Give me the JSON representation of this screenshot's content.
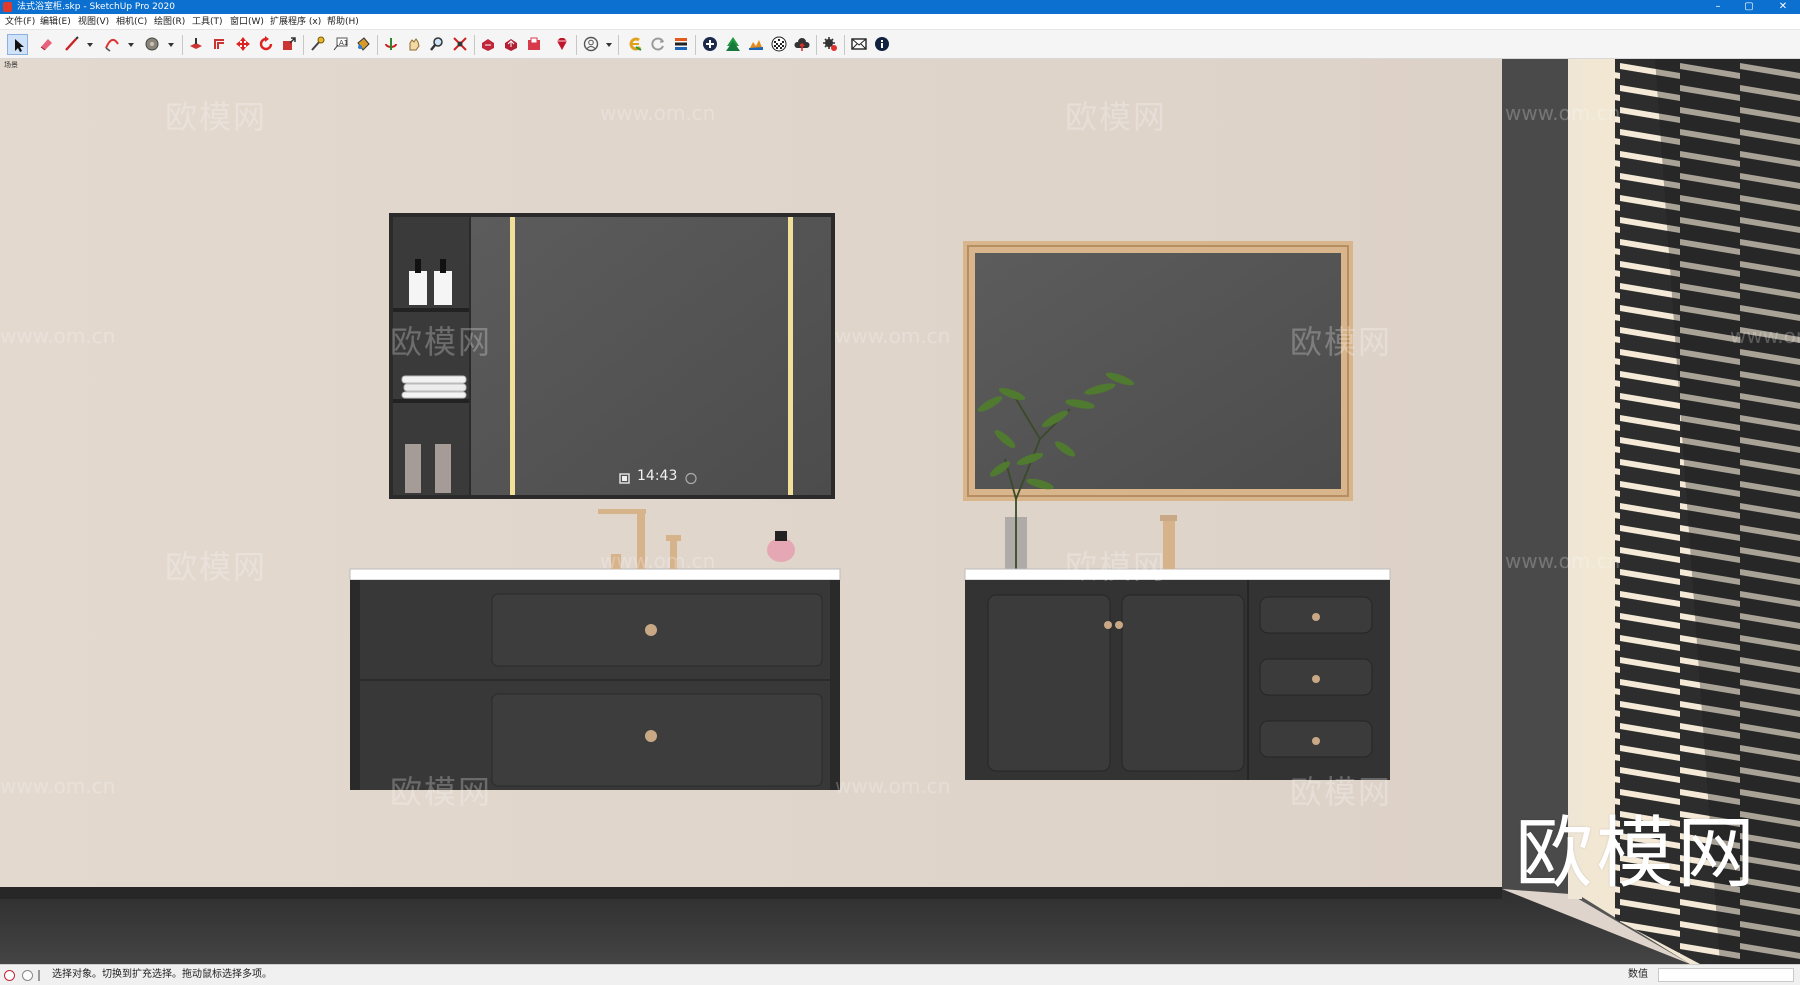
{
  "window": {
    "title": "法式浴室柜.skp - SketchUp Pro 2020",
    "controls": {
      "minimize": "–",
      "maximize": "▢",
      "close": "✕"
    }
  },
  "menu": [
    "文件(F)",
    "编辑(E)",
    "视图(V)",
    "相机(C)",
    "绘图(R)",
    "工具(T)",
    "窗口(W)",
    "扩展程序 (x)",
    "帮助(H)"
  ],
  "toolbar": {
    "tools": [
      {
        "name": "select-tool-icon",
        "selected": true
      },
      {
        "name": "eraser-tool-icon"
      },
      {
        "name": "line-tool-icon",
        "dropdown": true
      },
      {
        "name": "arc-tool-icon",
        "dropdown": true
      },
      {
        "name": "shapes-tool-icon",
        "dropdown": true
      },
      {
        "name": "push-pull-tool-icon"
      },
      {
        "name": "offset-tool-icon"
      },
      {
        "name": "move-tool-icon"
      },
      {
        "name": "rotate-tool-icon"
      },
      {
        "name": "scale-tool-icon"
      },
      {
        "name": "tape-measure-tool-icon"
      },
      {
        "name": "text-tool-icon"
      },
      {
        "name": "paint-bucket-tool-icon"
      },
      {
        "name": "orbit-tool-icon"
      },
      {
        "name": "pan-tool-icon"
      },
      {
        "name": "zoom-tool-icon"
      },
      {
        "name": "zoom-extents-tool-icon"
      },
      {
        "name": "warehouse-icon"
      },
      {
        "name": "share-model-icon"
      },
      {
        "name": "extension-warehouse-icon"
      },
      {
        "name": "ruby-console-icon"
      },
      {
        "name": "user-account-icon",
        "dropdown": true
      },
      {
        "name": "plugin-e-icon"
      },
      {
        "name": "refresh-icon"
      },
      {
        "name": "layers-stack-icon"
      },
      {
        "name": "add-circle-icon"
      },
      {
        "name": "tree-icon"
      },
      {
        "name": "terrain-icon"
      },
      {
        "name": "checker-sphere-icon"
      },
      {
        "name": "cloud-upload-icon"
      },
      {
        "name": "settings-icon"
      },
      {
        "name": "mail-icon"
      },
      {
        "name": "info-icon"
      }
    ]
  },
  "viewport": {
    "scene_label": "场景",
    "clock": "14:43",
    "watermarks": [
      "欧模网",
      "www.om.cn"
    ],
    "big_watermark": "欧模网"
  },
  "status": {
    "message": "选择对象。切换到扩充选择。拖动鼠标选择多项。",
    "measurements_label": "数值",
    "measurements_value": ""
  },
  "colors": {
    "titlebar": "#0b70d0",
    "wall": "#dfd4cb",
    "cabinet": "#3b3b3b",
    "gold": "#d7b38c",
    "floor": "#3d3d3d"
  }
}
